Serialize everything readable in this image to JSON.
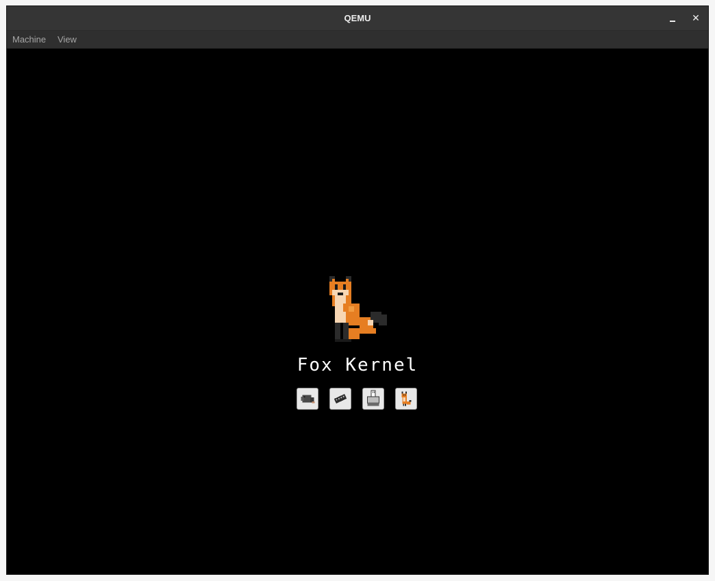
{
  "window": {
    "title": "QEMU",
    "minimize_glyph": "",
    "close_glyph": "✕"
  },
  "menu": {
    "items": [
      "Machine",
      "View"
    ]
  },
  "screen": {
    "brand_text": "Fox Kernel",
    "boot_modules": [
      {
        "icon": "mole-icon"
      },
      {
        "icon": "chip-icon"
      },
      {
        "icon": "usb-icon"
      },
      {
        "icon": "fox-icon"
      }
    ]
  },
  "colors": {
    "titlebar": "#353535",
    "menubar": "#2f2f2f",
    "screen_bg": "#000000",
    "fox_orange": "#e67e22",
    "fox_cream": "#f7d6b3",
    "fox_dark": "#2b2b2b"
  }
}
